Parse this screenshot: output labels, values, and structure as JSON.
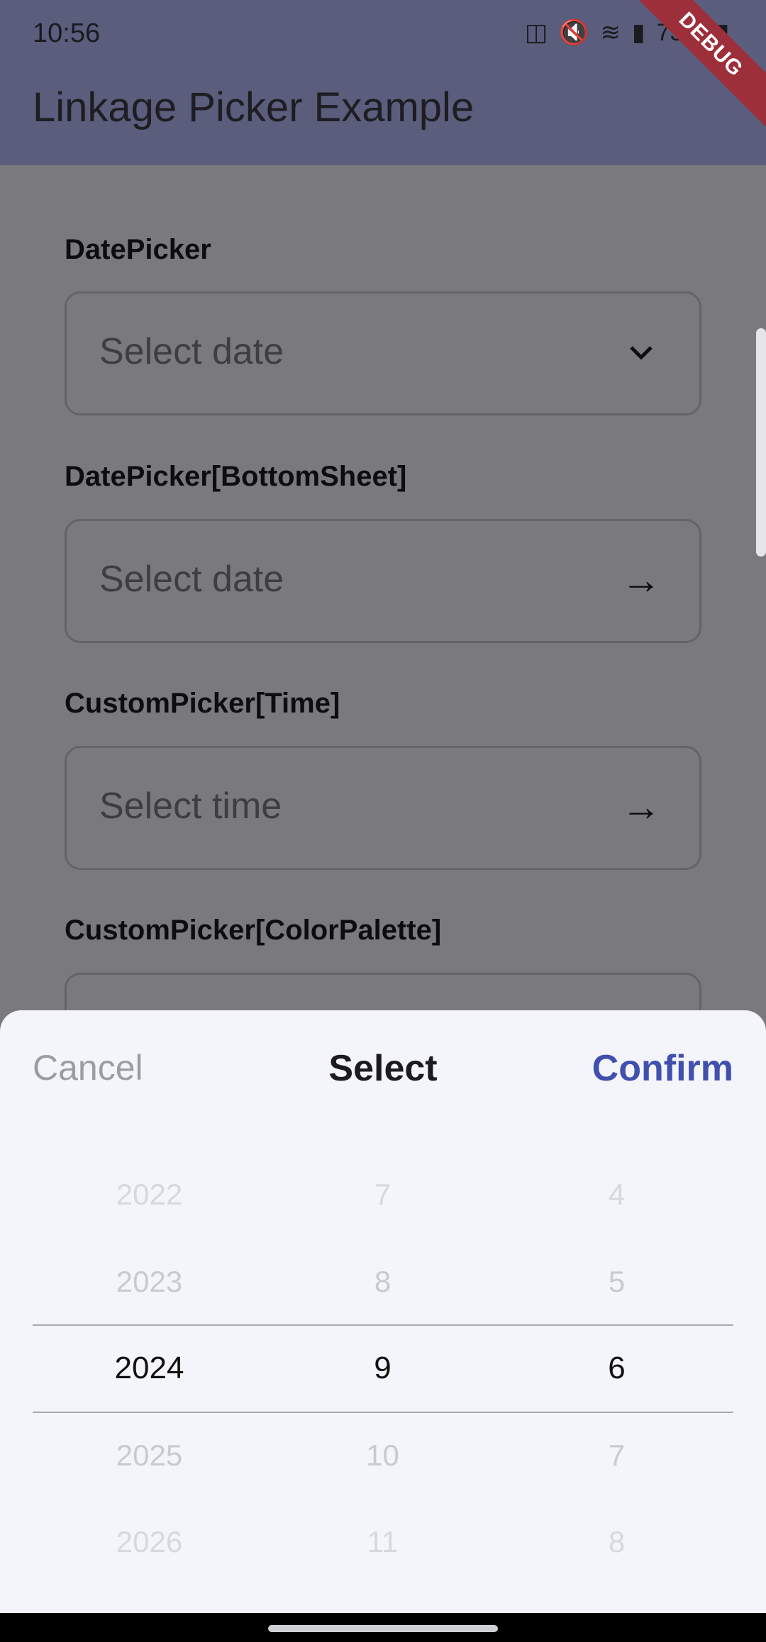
{
  "status_bar": {
    "time": "10:56",
    "battery": "73%",
    "icons": [
      "battery-saver-icon",
      "mute-icon",
      "wifi-icon",
      "signal-icon",
      "battery-icon"
    ]
  },
  "app_bar": {
    "title": "Linkage Picker Example",
    "debug_banner": "DEBUG",
    "color": "#5b5d7d"
  },
  "form": {
    "fields": [
      {
        "label": "DatePicker",
        "placeholder": "Select date",
        "trailing_icon": "chevron-down-icon"
      },
      {
        "label": "DatePicker[BottomSheet]",
        "placeholder": "Select date",
        "trailing_icon": "arrow-right-icon"
      },
      {
        "label": "CustomPicker[Time]",
        "placeholder": "Select time",
        "trailing_icon": "arrow-right-icon"
      },
      {
        "label": "CustomPicker[ColorPalette]"
      }
    ]
  },
  "sheet": {
    "cancel_label": "Cancel",
    "title": "Select",
    "confirm_label": "Confirm",
    "accent": "#4150ad",
    "columns": [
      {
        "items": [
          "2022",
          "2023",
          "2024",
          "2025",
          "2026"
        ],
        "selected": "2024"
      },
      {
        "items": [
          "7",
          "8",
          "9",
          "10",
          "11"
        ],
        "selected": "9"
      },
      {
        "items": [
          "4",
          "5",
          "6",
          "7",
          "8"
        ],
        "selected": "6"
      }
    ]
  }
}
